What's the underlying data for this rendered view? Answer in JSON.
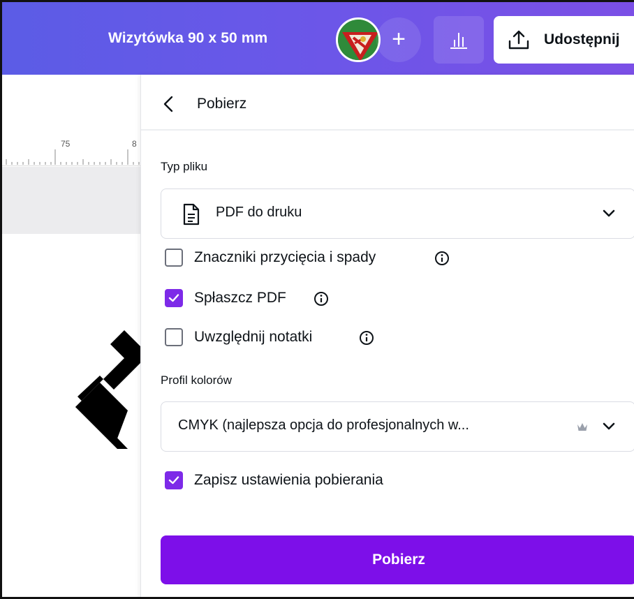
{
  "topbar": {
    "doc_title": "Wizytówka 90 x 50 mm",
    "avatar_icon": "user-avatar",
    "add_icon": "plus-icon",
    "add_symbol": "+",
    "stats_icon": "bar-chart-icon",
    "share_label": "Udostępnij",
    "share_icon": "upload-icon"
  },
  "ruler": {
    "label_75": "75",
    "label_8": "8"
  },
  "panel": {
    "title": "Pobierz",
    "back_icon": "chevron-left-icon",
    "file_type_label": "Typ pliku",
    "file_type_value": "PDF do druku",
    "file_type_icon": "document-icon",
    "options": [
      {
        "label": "Znaczniki przycięcia i spady",
        "checked": false,
        "info": true
      },
      {
        "label": "Spłaszcz PDF",
        "checked": true,
        "info": true
      },
      {
        "label": "Uwzględnij notatki",
        "checked": false,
        "info": true
      }
    ],
    "color_profile_label": "Profil kolorów",
    "color_profile_value": "CMYK (najlepsza opcja do profesjonalnych w...",
    "color_profile_icon": "crown-icon",
    "save_settings_label": "Zapisz ustawienia pobierania",
    "save_settings_checked": true,
    "download_button": "Pobierz"
  },
  "colors": {
    "accent": "#7d2ae8",
    "button": "#7d0fe9",
    "topbar_start": "#5b5ce6",
    "topbar_end": "#7b4fe6"
  }
}
